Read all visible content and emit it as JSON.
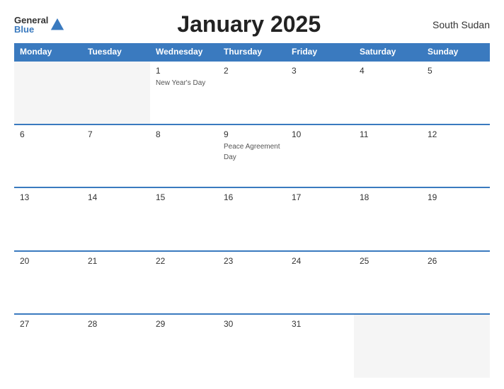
{
  "header": {
    "logo_general": "General",
    "logo_blue": "Blue",
    "title": "January 2025",
    "country": "South Sudan"
  },
  "days_of_week": [
    "Monday",
    "Tuesday",
    "Wednesday",
    "Thursday",
    "Friday",
    "Saturday",
    "Sunday"
  ],
  "weeks": [
    [
      {
        "day": "",
        "empty": true
      },
      {
        "day": "",
        "empty": true
      },
      {
        "day": "1",
        "holiday": "New Year's Day"
      },
      {
        "day": "2"
      },
      {
        "day": "3"
      },
      {
        "day": "4"
      },
      {
        "day": "5"
      }
    ],
    [
      {
        "day": "6"
      },
      {
        "day": "7"
      },
      {
        "day": "8"
      },
      {
        "day": "9",
        "holiday": "Peace Agreement Day"
      },
      {
        "day": "10"
      },
      {
        "day": "11"
      },
      {
        "day": "12"
      }
    ],
    [
      {
        "day": "13"
      },
      {
        "day": "14"
      },
      {
        "day": "15"
      },
      {
        "day": "16"
      },
      {
        "day": "17"
      },
      {
        "day": "18"
      },
      {
        "day": "19"
      }
    ],
    [
      {
        "day": "20"
      },
      {
        "day": "21"
      },
      {
        "day": "22"
      },
      {
        "day": "23"
      },
      {
        "day": "24"
      },
      {
        "day": "25"
      },
      {
        "day": "26"
      }
    ],
    [
      {
        "day": "27"
      },
      {
        "day": "28"
      },
      {
        "day": "29"
      },
      {
        "day": "30"
      },
      {
        "day": "31"
      },
      {
        "day": "",
        "empty": true
      },
      {
        "day": "",
        "empty": true
      }
    ]
  ]
}
